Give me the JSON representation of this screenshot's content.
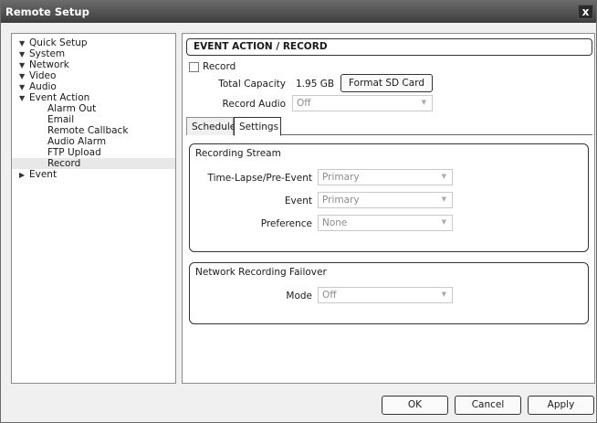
{
  "window": {
    "title": "Remote Setup",
    "close_glyph": "x"
  },
  "tree": {
    "items": [
      {
        "label": "Quick Setup",
        "expanded": true
      },
      {
        "label": "System",
        "expanded": true
      },
      {
        "label": "Network",
        "expanded": true
      },
      {
        "label": "Video",
        "expanded": true
      },
      {
        "label": "Audio",
        "expanded": true
      },
      {
        "label": "Event Action",
        "expanded": true
      },
      {
        "label": "Alarm Out"
      },
      {
        "label": "Email"
      },
      {
        "label": "Remote Callback"
      },
      {
        "label": "Audio Alarm"
      },
      {
        "label": "FTP Upload"
      },
      {
        "label": "Record",
        "selected": true
      },
      {
        "label": "Event",
        "expanded": false
      }
    ]
  },
  "panel": {
    "header": "EVENT ACTION / RECORD",
    "record_label": "Record",
    "record_checked": false,
    "total_capacity_label": "Total Capacity",
    "total_capacity_value": "1.95 GB",
    "format_button": "Format SD Card",
    "record_audio_label": "Record Audio",
    "record_audio_value": "Off",
    "tabs": [
      {
        "label": "Schedule",
        "active": false
      },
      {
        "label": "Settings",
        "active": true
      }
    ],
    "recording_stream": {
      "title": "Recording Stream",
      "time_lapse_label": "Time-Lapse/Pre-Event",
      "time_lapse_value": "Primary",
      "event_label": "Event",
      "event_value": "Primary",
      "preference_label": "Preference",
      "preference_value": "None"
    },
    "failover": {
      "title": "Network Recording Failover",
      "mode_label": "Mode",
      "mode_value": "Off"
    }
  },
  "footer": {
    "ok": "OK",
    "cancel": "Cancel",
    "apply": "Apply"
  },
  "icons": {
    "expanded": "tree-expanded-icon",
    "collapsed": "tree-collapsed-icon",
    "dropdown": "chevron-down-icon"
  }
}
